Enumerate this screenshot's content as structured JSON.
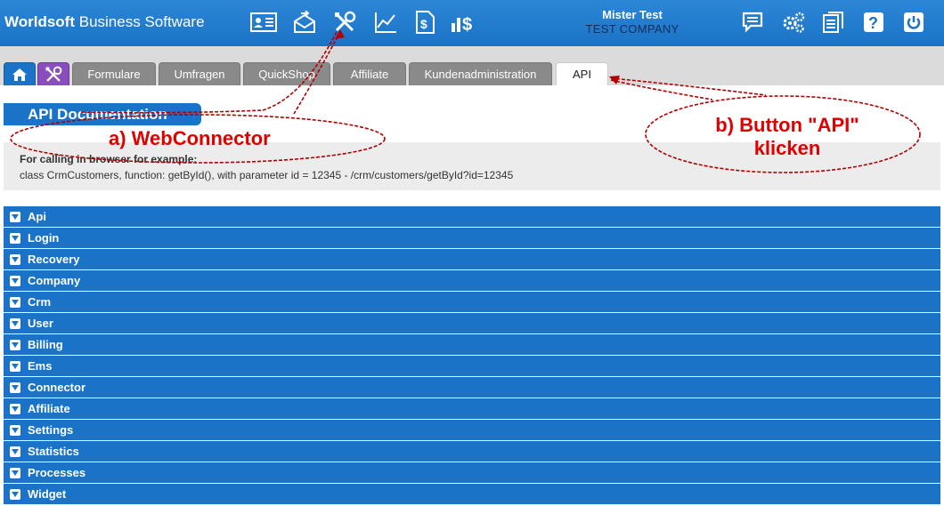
{
  "header": {
    "brand_bold": "Worldsoft",
    "brand_rest": " Business Software",
    "user_name": "Mister Test",
    "company": "TEST COMPANY",
    "icons_left": [
      "contact-card-icon",
      "mail-send-icon",
      "tools-icon",
      "chart-icon",
      "invoice-icon",
      "finance-icon"
    ],
    "icons_right": [
      "chat-icon",
      "settings-icon",
      "documents-icon",
      "help-icon",
      "power-icon"
    ]
  },
  "tabs": [
    {
      "label": "Formulare"
    },
    {
      "label": "Umfragen"
    },
    {
      "label": "QuickShop"
    },
    {
      "label": "Affiliate"
    },
    {
      "label": "Kundenadministration"
    },
    {
      "label": "API"
    }
  ],
  "content": {
    "title": "API Documentation",
    "info_heading": "For calling in browser for example:",
    "info_example": "class CrmCustomers, function: getById(), with parameter id = 12345 - /crm/customers/getById?id=12345"
  },
  "sections": [
    "Api",
    "Login",
    "Recovery",
    "Company",
    "Crm",
    "User",
    "Billing",
    "Ems",
    "Connector",
    "Affiliate",
    "Settings",
    "Statistics",
    "Processes",
    "Widget"
  ],
  "annotations": {
    "a": "a) WebConnector",
    "b_line1": "b) Button \"API\"",
    "b_line2": "klicken"
  },
  "colors": {
    "primary": "#1a73c6",
    "annotation": "#e00000",
    "tools_tab": "#8a4dbd"
  }
}
